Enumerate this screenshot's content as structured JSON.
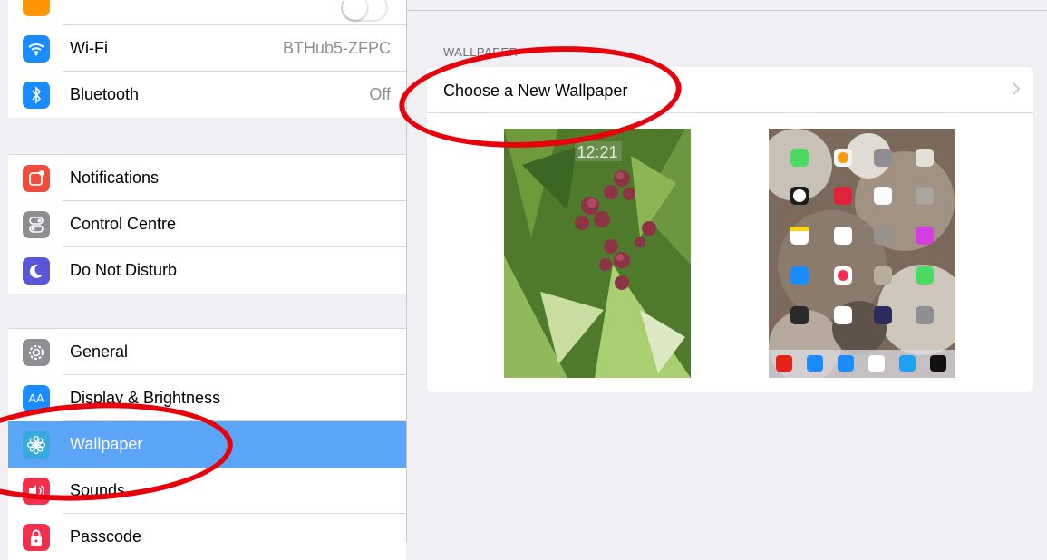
{
  "sidebar": {
    "group1": [
      {
        "label": "Wi-Fi",
        "value": "BTHub5-ZFPC",
        "icon": "wifi-icon",
        "color": "#1a8cff"
      },
      {
        "label": "Bluetooth",
        "value": "Off",
        "icon": "bluetooth-icon",
        "color": "#1a8cff"
      }
    ],
    "group2": [
      {
        "label": "Notifications",
        "icon": "notifications-icon",
        "color": "#f24c3d"
      },
      {
        "label": "Control Centre",
        "icon": "control-centre-icon",
        "color": "#8e8e93"
      },
      {
        "label": "Do Not Disturb",
        "icon": "moon-icon",
        "color": "#5856d6"
      }
    ],
    "group3": [
      {
        "label": "General",
        "icon": "gear-icon",
        "color": "#8e8e93"
      },
      {
        "label": "Display & Brightness",
        "icon_text": "AA",
        "icon": "display-brightness-icon",
        "color": "#1a8cff"
      },
      {
        "label": "Wallpaper",
        "icon": "wallpaper-flower-icon",
        "color": "#35aadc",
        "selected": true
      },
      {
        "label": "Sounds",
        "icon": "speaker-icon",
        "color": "#f2304d"
      },
      {
        "label": "Passcode",
        "icon": "lock-icon",
        "color": "#f2304d"
      }
    ]
  },
  "detail": {
    "section_title": "WALLPAPER",
    "choose_label": "Choose a New Wallpaper",
    "lock_screen_time": "12:21"
  },
  "colors": {
    "selected_row": "#5aa5f7",
    "annotation_ring": "#e8000a"
  }
}
